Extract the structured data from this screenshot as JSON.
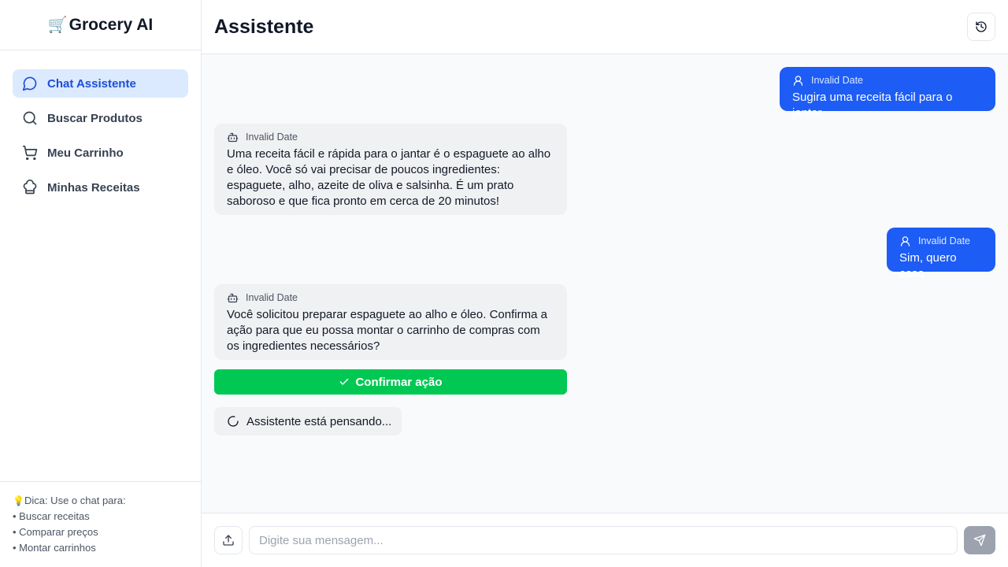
{
  "app": {
    "brand_emoji": "🛒",
    "brand_name": "Grocery AI"
  },
  "sidebar": {
    "items": [
      {
        "label": "Chat Assistente",
        "icon": "message-circle-icon",
        "active": true
      },
      {
        "label": "Buscar Produtos",
        "icon": "search-icon",
        "active": false
      },
      {
        "label": "Meu Carrinho",
        "icon": "shopping-cart-icon",
        "active": false
      },
      {
        "label": "Minhas Receitas",
        "icon": "chef-hat-icon",
        "active": false
      }
    ],
    "tip": {
      "emoji": "💡",
      "title": "Dica: Use o chat para:",
      "lines": [
        "• Buscar receitas",
        "• Comparar preços",
        "• Montar carrinhos"
      ]
    }
  },
  "header": {
    "title": "Assistente",
    "history_icon": "history-icon"
  },
  "messages": [
    {
      "role": "user",
      "timestamp": "Invalid Date",
      "text": "Sugira uma receita fácil para o jantar"
    },
    {
      "role": "assistant",
      "timestamp": "Invalid Date",
      "text": "Uma receita fácil e rápida para o jantar é o espaguete ao alho e óleo. Você só vai precisar de poucos ingredientes: espaguete, alho, azeite de oliva e salsinha. É um prato saboroso e que fica pronto em cerca de 20 minutos!"
    },
    {
      "role": "user",
      "timestamp": "Invalid Date",
      "text": "Sim, quero essa"
    },
    {
      "role": "assistant",
      "timestamp": "Invalid Date",
      "text": "Você solicitou preparar espaguete ao alho e óleo. Confirma a ação para que eu possa montar o carrinho de compras com os ingredientes necessários?"
    }
  ],
  "confirm_button": {
    "label": "Confirmar ação"
  },
  "thinking": {
    "label": "Assistente está pensando..."
  },
  "composer": {
    "placeholder": "Digite sua mensagem...",
    "value": ""
  },
  "colors": {
    "primary": "#1d5cf5",
    "active_nav_bg": "#dbeafe",
    "active_nav_text": "#1d4ed8",
    "confirm": "#00c853",
    "send_disabled": "#9ca3af"
  }
}
